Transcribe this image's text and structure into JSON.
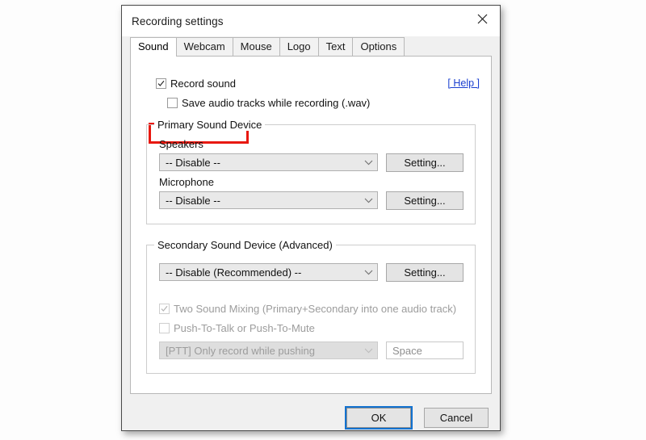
{
  "window": {
    "title": "Recording settings",
    "close_icon": "close-x-icon"
  },
  "tabs": [
    {
      "label": "Sound",
      "active": true
    },
    {
      "label": "Webcam",
      "active": false
    },
    {
      "label": "Mouse",
      "active": false
    },
    {
      "label": "Logo",
      "active": false
    },
    {
      "label": "Text",
      "active": false
    },
    {
      "label": "Options",
      "active": false
    }
  ],
  "sound_tab": {
    "record_sound": {
      "label": "Record sound",
      "checked": true,
      "highlighted": true,
      "highlight_color": "#e8180f"
    },
    "save_audio_tracks": {
      "label": "Save audio tracks while recording (.wav)",
      "checked": false
    },
    "help_link": {
      "label": "[ Help ]",
      "color": "#1a3fd0"
    },
    "primary_group": {
      "title": "Primary Sound Device",
      "speakers": {
        "label": "Speakers",
        "value": "-- Disable --",
        "setting_button": "Setting..."
      },
      "microphone": {
        "label": "Microphone",
        "value": "-- Disable --",
        "setting_button": "Setting..."
      }
    },
    "secondary_group": {
      "title": "Secondary Sound Device (Advanced)",
      "device": {
        "value": "-- Disable (Recommended) --",
        "setting_button": "Setting..."
      },
      "two_sound_mixing": {
        "label": "Two Sound Mixing (Primary+Secondary into one audio track)",
        "checked": true,
        "disabled": true
      },
      "push_to_talk": {
        "label": "Push-To-Talk or Push-To-Mute",
        "checked": false,
        "disabled": true
      },
      "ptt_mode": {
        "value": "[PTT] Only record while pushing",
        "disabled": true
      },
      "ptt_key": {
        "value": "Space",
        "disabled": true
      }
    }
  },
  "footer": {
    "ok_label": "OK",
    "cancel_label": "Cancel"
  }
}
